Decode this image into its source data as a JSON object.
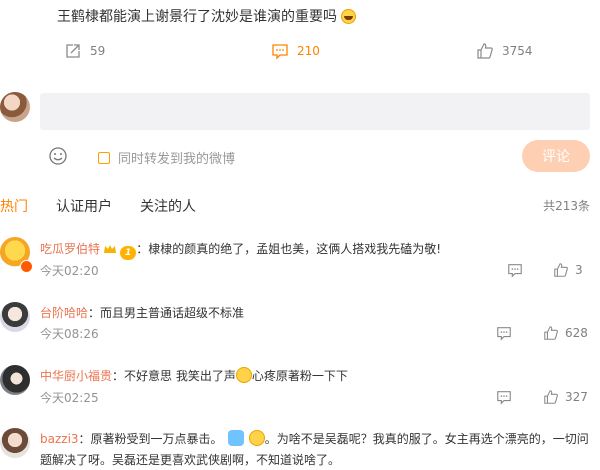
{
  "post": {
    "text": "王鹤棣都能演上谢景行了沈妙是谁演的重要吗"
  },
  "actions": {
    "repost_count": "59",
    "comment_count": "210",
    "like_count": "3754"
  },
  "composer": {
    "repost_label": "同时转发到我的微博",
    "submit_label": "评论"
  },
  "tabs": {
    "hot": "热门",
    "verified": "认证用户",
    "following": "关注的人"
  },
  "total": "共213条",
  "comments": [
    {
      "name": "吃瓜罗伯特",
      "badge": "1",
      "text": "：棣棣的颜真的绝了，孟姐也美，这俩人搭戏我先磕为敬!",
      "time": "今天02:20",
      "likes": "3"
    },
    {
      "name": "台阶哈哈",
      "text": "：而且男主普通话超级不标准",
      "time": "今天08:26",
      "likes": "628"
    },
    {
      "name": "中华厨小福贵",
      "text_a": "：不好意思 我笑出了声",
      "text_b": "心疼原著粉一下下",
      "time": "今天02:25",
      "likes": "327"
    },
    {
      "name": "bazzi3",
      "text_a": "：原著粉受到一万点暴击。",
      "text_b": "。为啥不是吴磊呢？我真的服了。女主再选个漂亮的，一切问",
      "text_c": "题解决了呀。吴磊还是更喜欢武侠剧啊，不知道说啥了。"
    }
  ],
  "colors": {
    "accent": "#ff8200",
    "username": "#eb7350",
    "submit_bg": "#ffcfb3",
    "input_bg": "#f2f2f5"
  }
}
